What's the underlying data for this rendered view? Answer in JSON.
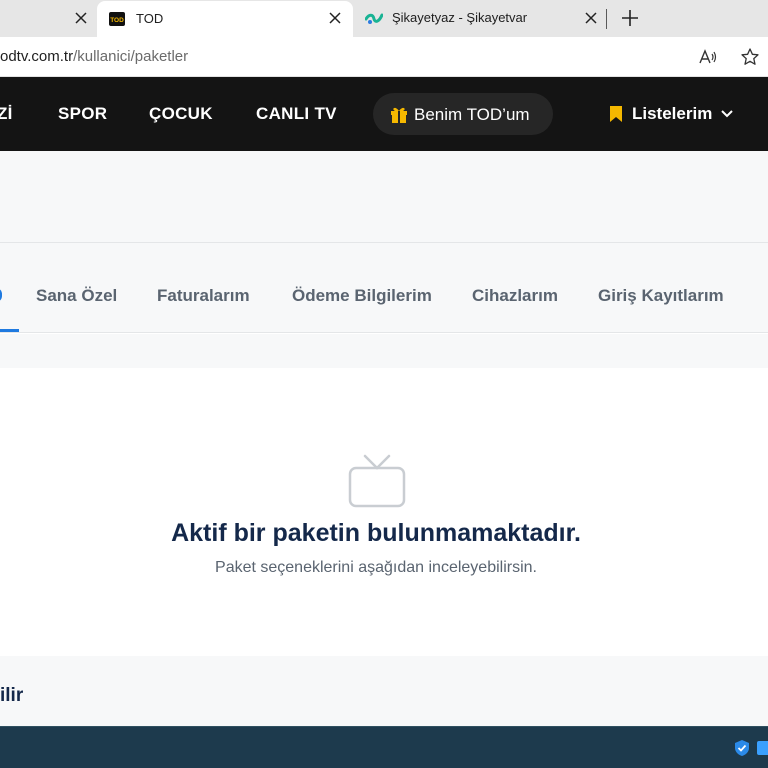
{
  "browser": {
    "tabs": [
      {
        "title": "",
        "state": "inactive"
      },
      {
        "title": "TOD",
        "state": "active",
        "favicon": "tod-logo-icon"
      },
      {
        "title": "Şikayetyaz - Şikayetvar",
        "state": "inactive",
        "favicon": "sikayetvar-logo-icon"
      }
    ],
    "tod_favicon_text": "TOD",
    "url_host": "odtv.com.tr",
    "url_path": "/kullanici/paketler",
    "icons": [
      "close-icon",
      "plus-icon",
      "read-aloud-icon",
      "star-icon"
    ]
  },
  "nav": {
    "cut_item": "Zİ",
    "items": [
      "SPOR",
      "ÇOCUK",
      "CANLI TV"
    ],
    "my_tod": "Benim TOD’um",
    "lists": "Listelerim",
    "colors": {
      "background": "#141414",
      "accent": "#f5b800"
    }
  },
  "account_tabs": {
    "items": [
      "Sana Özel",
      "Faturalarım",
      "Ödeme Bilgilerim",
      "Cihazlarım",
      "Giriş Kayıtlarım"
    ],
    "active_color": "#1f7ae0"
  },
  "empty_state": {
    "icon": "tv-icon",
    "title": "Aktif bir paketin bulunmamaktadır.",
    "subtitle": "Paket seçeneklerini aşağıdan inceleyebilirsin."
  },
  "section": {
    "title_cut": "ilir"
  },
  "taskbar": {
    "icons": [
      "shield-icon",
      "tray-app-icon"
    ]
  }
}
